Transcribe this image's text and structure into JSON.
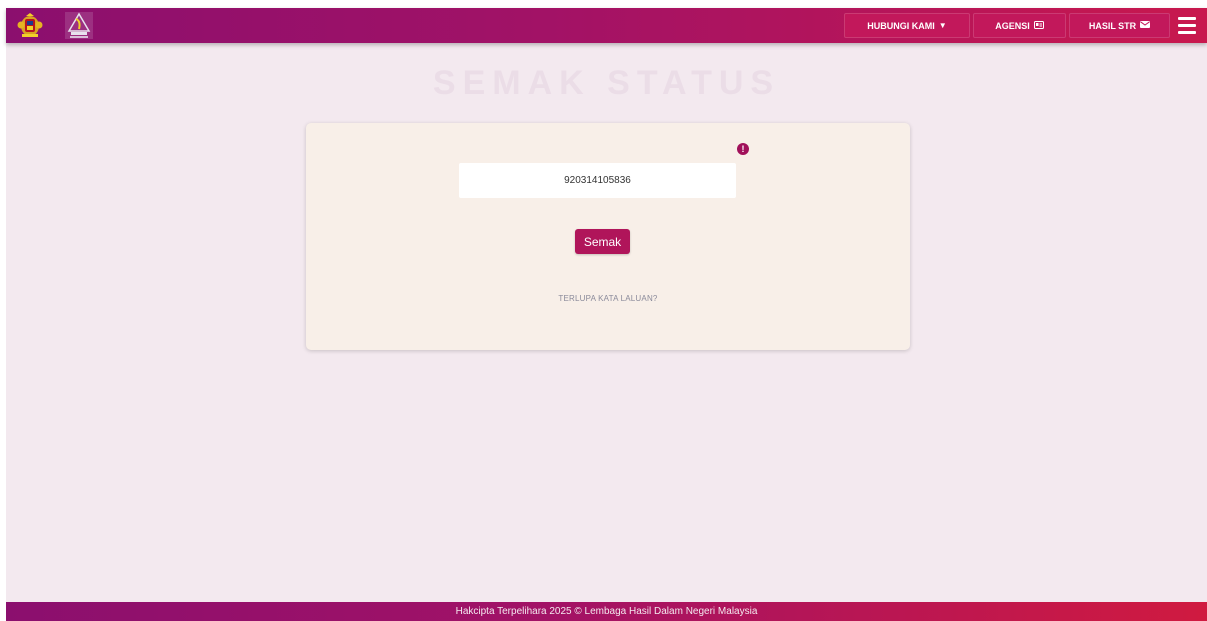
{
  "header": {
    "logos": [
      "malaysia-coat-of-arms-icon",
      "lhdn-logo-icon"
    ],
    "nav": [
      {
        "label": "HUBUNGI KAMI",
        "icon": "caret-down-icon"
      },
      {
        "label": "AGENSI",
        "icon": "id-card-icon"
      },
      {
        "label": "HASIL STR",
        "icon": "envelope-icon"
      }
    ],
    "menu_icon": "hamburger-menu-icon"
  },
  "main": {
    "title": "SEMAK STATUS",
    "form": {
      "alert_icon": "exclamation-circle-icon",
      "ic_value": "920314105836",
      "submit_label": "Semak",
      "forgot_link": "TERLUPA KATA LALUAN?"
    }
  },
  "footer": {
    "text": "Hakcipta Terpelihara 2025 © Lembaga Hasil Dalam Negeri Malaysia"
  },
  "colors": {
    "brand_start": "#8b0f6e",
    "brand_end": "#c8184e",
    "button": "#b0155a",
    "card_bg": "#f8efe8",
    "page_bg": "#f3e9ef"
  }
}
